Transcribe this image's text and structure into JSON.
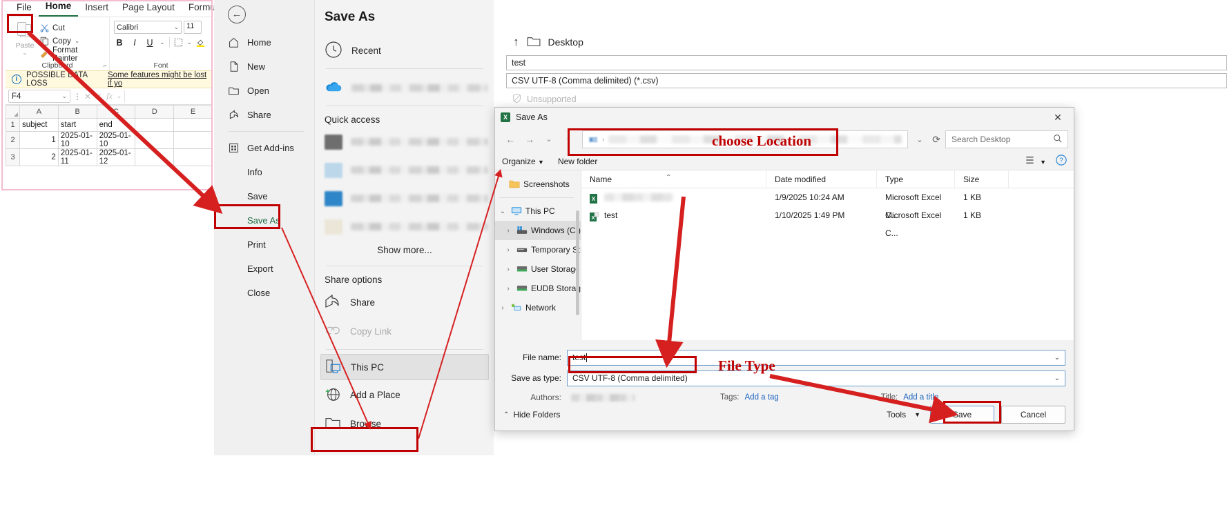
{
  "excel": {
    "ribbon_tabs": [
      "File",
      "Home",
      "Insert",
      "Page Layout",
      "Formulas"
    ],
    "clipboard": {
      "paste": "Paste",
      "cut": "Cut",
      "copy": "Copy",
      "format_painter": "Format Painter",
      "group_label": "Clipboard"
    },
    "font": {
      "name": "Calibri",
      "size": "11",
      "bold": "B",
      "italic": "I",
      "underline": "U",
      "group_label": "Font"
    },
    "warning": {
      "title": "POSSIBLE DATA LOSS",
      "message": "Some features might be lost if yo"
    },
    "formula_bar": {
      "namebox": "F4",
      "formula_value": ""
    },
    "grid": {
      "columns": [
        "A",
        "B",
        "C",
        "D",
        "E"
      ],
      "rows": [
        {
          "num": "1",
          "cells": [
            "subject",
            "start",
            "end",
            "",
            ""
          ]
        },
        {
          "num": "2",
          "cells": [
            "1",
            "2025-01-10",
            "2025-01-10",
            "",
            ""
          ]
        },
        {
          "num": "3",
          "cells": [
            "2",
            "2025-01-11",
            "2025-01-12",
            "",
            ""
          ]
        }
      ]
    }
  },
  "backstage": {
    "back_icon": "←",
    "items": [
      {
        "label": "Home",
        "icon": "home-icon"
      },
      {
        "label": "New",
        "icon": "new-document-icon"
      },
      {
        "label": "Open",
        "icon": "open-folder-icon"
      },
      {
        "label": "Share",
        "icon": "share-icon"
      },
      {
        "label": "Get Add-ins",
        "icon": "add-ins-icon"
      },
      {
        "label": "Info",
        "icon": ""
      },
      {
        "label": "Save",
        "icon": ""
      },
      {
        "label": "Save As",
        "icon": ""
      },
      {
        "label": "Print",
        "icon": ""
      },
      {
        "label": "Export",
        "icon": ""
      },
      {
        "label": "Close",
        "icon": ""
      }
    ]
  },
  "save_as_pane": {
    "title": "Save As",
    "recent": "Recent",
    "quick_access": "Quick access",
    "show_more": "Show more...",
    "share_options": "Share options",
    "share": "Share",
    "copy_link": "Copy Link",
    "this_pc": "This PC",
    "add_a_place": "Add a Place",
    "browse": "Browse"
  },
  "save_fields": {
    "location": "Desktop",
    "up_icon": "↑",
    "file_name": "test",
    "file_type": "CSV UTF-8 (Comma delimited) (*.csv)",
    "unsupported": "Unsupported"
  },
  "dialog": {
    "title": "Save As",
    "close": "✕",
    "search_placeholder": "Search Desktop",
    "organize": "Organize",
    "new_folder": "New folder",
    "help": "?",
    "nav": [
      {
        "label": "Screenshots",
        "icon": "folder-icon",
        "expand": "",
        "indent": 1,
        "selected": false
      },
      {
        "label": "This PC",
        "icon": "this-pc-icon",
        "expand": "⌄",
        "indent": 0,
        "selected": false
      },
      {
        "label": "Windows (C:)",
        "icon": "drive-windows-icon",
        "expand": "›",
        "indent": 1,
        "selected": true
      },
      {
        "label": "Temporary Sto",
        "icon": "drive-icon",
        "expand": "›",
        "indent": 1,
        "selected": false
      },
      {
        "label": "User Storage -",
        "icon": "network-drive-icon",
        "expand": "›",
        "indent": 1,
        "selected": false
      },
      {
        "label": "EUDB Storage",
        "icon": "network-drive-icon",
        "expand": "›",
        "indent": 1,
        "selected": false
      },
      {
        "label": "Network",
        "icon": "network-icon",
        "expand": "›",
        "indent": 0,
        "selected": false
      }
    ],
    "columns": [
      "Name",
      "Date modified",
      "Type",
      "Size"
    ],
    "files": [
      {
        "name": "",
        "redacted": true,
        "date": "1/9/2025 10:24 AM",
        "type": "Microsoft Excel C...",
        "size": "1 KB"
      },
      {
        "name": "test",
        "redacted": false,
        "date": "1/10/2025 1:49 PM",
        "type": "Microsoft Excel C...",
        "size": "1 KB"
      }
    ],
    "form": {
      "file_name_label": "File name:",
      "file_name_value": "test",
      "save_as_type_label": "Save as type:",
      "save_as_type_value": "CSV UTF-8 (Comma delimited)",
      "authors_label": "Authors:",
      "tags_label": "Tags:",
      "tags_value": "Add a tag",
      "title_label": "Title:",
      "title_value": "Add a title"
    },
    "footer": {
      "hide_folders": "Hide Folders",
      "tools": "Tools",
      "save": "Save",
      "cancel": "Cancel"
    }
  },
  "annotations": {
    "choose_location": "choose Location",
    "file_type": "File Type",
    "accent_color": "#c00000"
  }
}
